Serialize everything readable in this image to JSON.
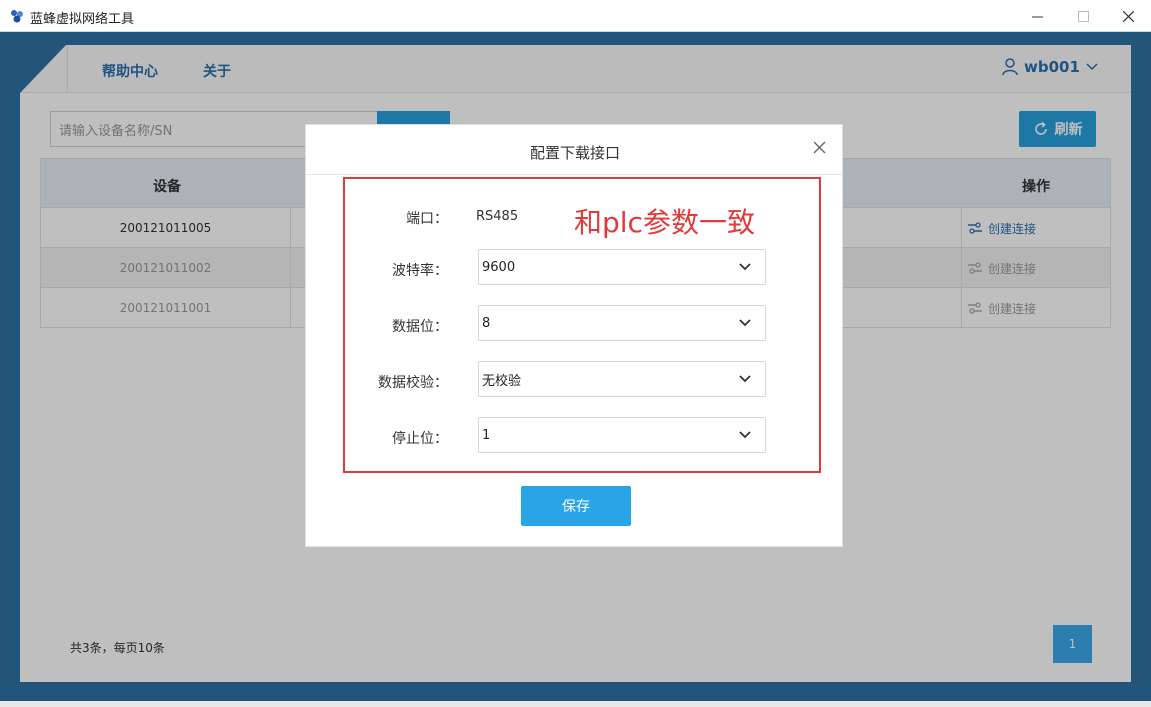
{
  "window": {
    "title": "蓝蜂虚拟网络工具",
    "icon": "bee-logo-icon"
  },
  "nav": {
    "links": [
      "帮助中心",
      "关于"
    ],
    "user": "wb001"
  },
  "search": {
    "placeholder": "请输入设备名称/SN"
  },
  "toolbar": {
    "refresh_label": "刷新"
  },
  "table": {
    "headers": {
      "device": "设备",
      "operation": "操作"
    },
    "rows": [
      {
        "sn": "200121011005",
        "action": "创建连接",
        "enabled": true
      },
      {
        "sn": "200121011002",
        "action": "创建连接",
        "enabled": false
      },
      {
        "sn": "200121011001",
        "action": "创建连接",
        "enabled": false
      }
    ]
  },
  "footer": {
    "count_text": "共3条，每页10条",
    "page": "1"
  },
  "modal": {
    "title": "配置下载接口",
    "annotation": "和plc参数一致",
    "port_label": "端口：",
    "port_value": "RS485",
    "fields": [
      {
        "label": "波特率：",
        "value": "9600"
      },
      {
        "label": "数据位：",
        "value": "8"
      },
      {
        "label": "数据校验：",
        "value": "无校验"
      },
      {
        "label": "停止位：",
        "value": "1"
      }
    ],
    "save_label": "保存"
  },
  "colors": {
    "frame": "#2f72a3",
    "accent": "#29a0dc",
    "annotation": "#e23a3a"
  }
}
